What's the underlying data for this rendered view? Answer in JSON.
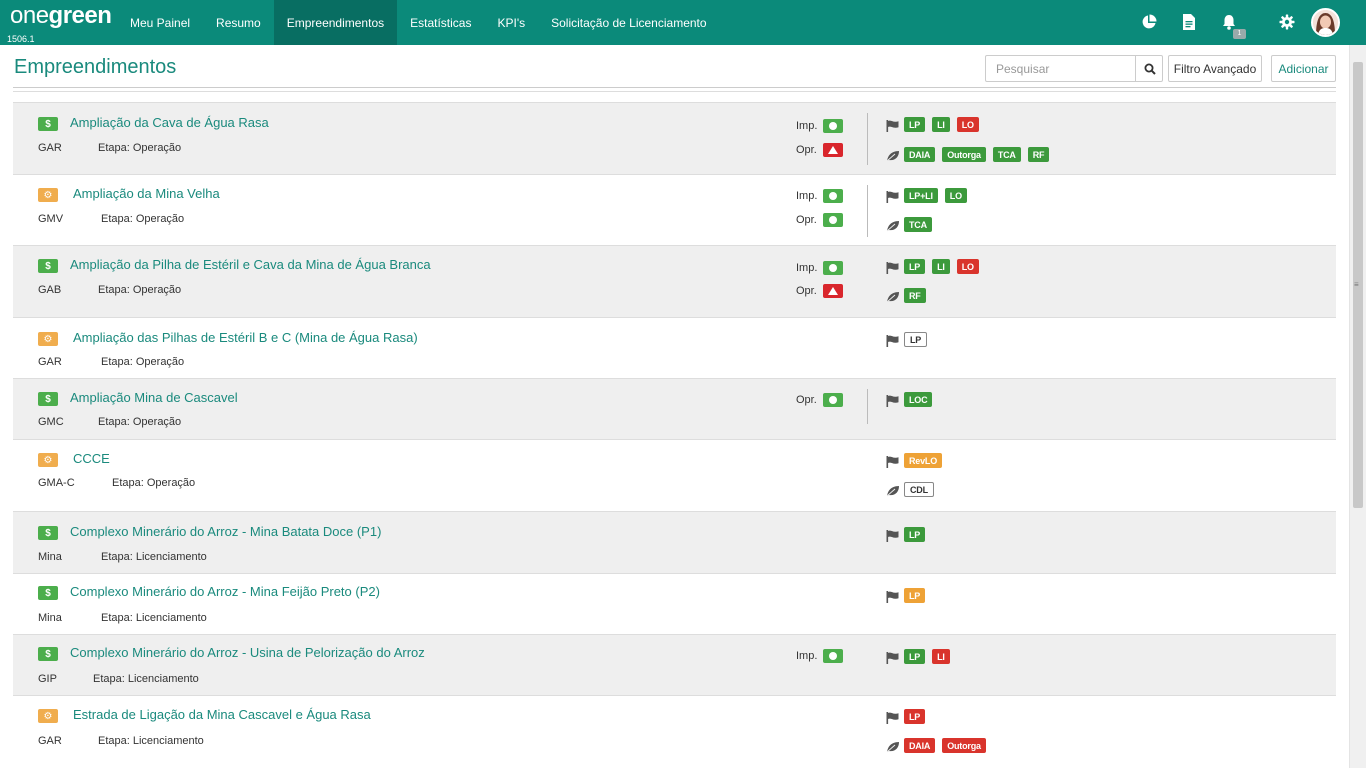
{
  "app": {
    "logo_one": "one",
    "logo_green": "green",
    "version": "1506.1"
  },
  "nav": [
    {
      "label": "Meu Painel",
      "active": false
    },
    {
      "label": "Resumo",
      "active": false
    },
    {
      "label": "Empreendimentos",
      "active": true
    },
    {
      "label": "Estatísticas",
      "active": false
    },
    {
      "label": "KPI's",
      "active": false
    },
    {
      "label": "Solicitação de Licenciamento",
      "active": false
    }
  ],
  "topicons": {
    "notif_count": "1",
    "icons": [
      "pie-chart-icon",
      "document-icon",
      "bell-icon",
      "gear-icon"
    ]
  },
  "page": {
    "title": "Empreendimentos",
    "search_placeholder": "Pesquisar",
    "filter_label": "Filtro Avançado",
    "add_label": "Adicionar"
  },
  "colors": {
    "brand": "#0b8a7a",
    "ok": "#4cae4c",
    "danger": "#d9342c",
    "warn": "#eea236"
  },
  "rows": [
    {
      "name": "Ampliação da Cava de Água Rasa",
      "code": "GAR",
      "stage": "Etapa: Operação",
      "cat": "money",
      "imp": "Imp.",
      "imp_status": "ok",
      "opr": "Opr.",
      "opr_status": "warn",
      "licenses": [
        {
          "t": "LP",
          "c": "g"
        },
        {
          "t": "LI",
          "c": "g"
        },
        {
          "t": "LO",
          "c": "r"
        }
      ],
      "env": [
        {
          "t": "DAIA",
          "c": "g"
        },
        {
          "t": "Outorga",
          "c": "g"
        },
        {
          "t": "TCA",
          "c": "g"
        },
        {
          "t": "RF",
          "c": "g"
        }
      ]
    },
    {
      "name": "Ampliação da Mina Velha",
      "code": "GMV",
      "stage": "Etapa: Operação",
      "cat": "gear",
      "imp": "Imp.",
      "imp_status": "ok",
      "opr": "Opr.",
      "opr_status": "ok",
      "licenses": [
        {
          "t": "LP+LI",
          "c": "g"
        },
        {
          "t": "LO",
          "c": "g"
        }
      ],
      "env": [
        {
          "t": "TCA",
          "c": "g"
        }
      ]
    },
    {
      "name": "Ampliação da Pilha de Estéril e Cava da Mina de Água Branca",
      "code": "GAB",
      "stage": "Etapa: Operação",
      "cat": "money",
      "imp": "Imp.",
      "imp_status": "ok",
      "opr": "Opr.",
      "opr_status": "warn",
      "licenses": [
        {
          "t": "LP",
          "c": "g"
        },
        {
          "t": "LI",
          "c": "g"
        },
        {
          "t": "LO",
          "c": "r"
        }
      ],
      "env": [
        {
          "t": "RF",
          "c": "g"
        }
      ]
    },
    {
      "name": "Ampliação das Pilhas de Estéril B e C (Mina de Água Rasa)",
      "code": "GAR",
      "stage": "Etapa: Operação",
      "cat": "gear",
      "licenses": [
        {
          "t": "LP",
          "c": "w"
        }
      ],
      "env": []
    },
    {
      "name": "Ampliação Mina de Cascavel",
      "code": "GMC",
      "stage": "Etapa: Operação",
      "cat": "money",
      "opr": "Opr.",
      "opr_status": "ok",
      "licenses": [
        {
          "t": "LOC",
          "c": "g"
        }
      ],
      "env": []
    },
    {
      "name": "CCCE",
      "code": "GMA-C",
      "stage": "Etapa: Operação",
      "cat": "gear",
      "licenses": [
        {
          "t": "RevLO",
          "c": "o"
        }
      ],
      "env": [
        {
          "t": "CDL",
          "c": "w"
        }
      ]
    },
    {
      "name": "Complexo Minerário do Arroz - Mina Batata Doce (P1)",
      "code": "Mina",
      "stage": "Etapa: Licenciamento",
      "cat": "money",
      "licenses": [
        {
          "t": "LP",
          "c": "g"
        }
      ],
      "env": []
    },
    {
      "name": "Complexo Minerário do Arroz - Mina Feijão Preto (P2)",
      "code": "Mina",
      "stage": "Etapa: Licenciamento",
      "cat": "money",
      "licenses": [
        {
          "t": "LP",
          "c": "o"
        }
      ],
      "env": []
    },
    {
      "name": "Complexo Minerário do Arroz - Usina de Pelorização do Arroz",
      "code": "GIP",
      "stage": "Etapa: Licenciamento",
      "cat": "money",
      "imp": "Imp.",
      "imp_status": "ok",
      "licenses": [
        {
          "t": "LP",
          "c": "g"
        },
        {
          "t": "LI",
          "c": "r"
        }
      ],
      "env": []
    },
    {
      "name": "Estrada de Ligação da Mina Cascavel e Água Rasa",
      "code": "GAR",
      "stage": "Etapa: Licenciamento",
      "cat": "gear",
      "licenses": [
        {
          "t": "LP",
          "c": "r"
        }
      ],
      "env": [
        {
          "t": "DAIA",
          "c": "r"
        },
        {
          "t": "Outorga",
          "c": "r"
        }
      ]
    }
  ]
}
